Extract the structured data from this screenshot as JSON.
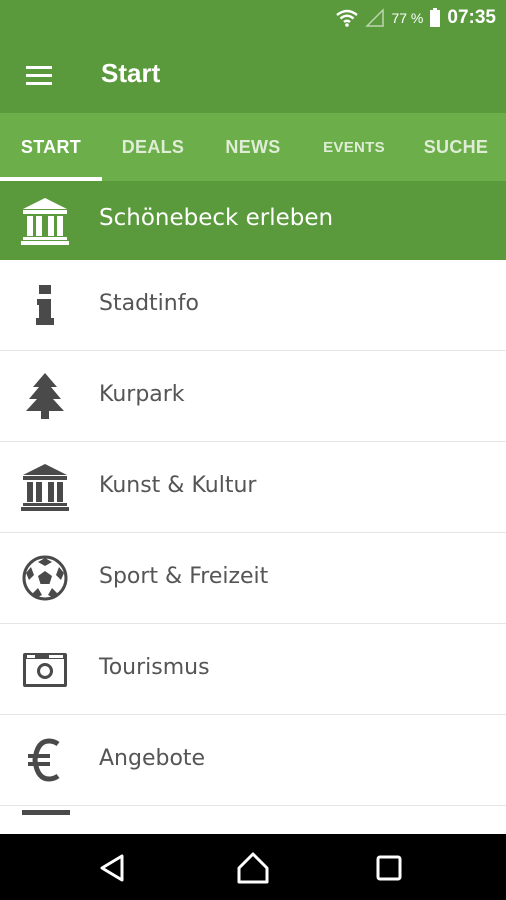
{
  "status_bar": {
    "battery_percent": "77 %",
    "time": "07:35",
    "icons": [
      "wifi-icon",
      "signal-icon",
      "battery-icon"
    ]
  },
  "app_bar": {
    "title": "Start",
    "menu_icon": "hamburger-menu-icon"
  },
  "tabs": [
    {
      "label": "START",
      "active": true
    },
    {
      "label": "DEALS",
      "active": false
    },
    {
      "label": "NEWS",
      "active": false
    },
    {
      "label": "EVENTS",
      "active": false
    },
    {
      "label": "SUCHE",
      "active": false
    }
  ],
  "featured": {
    "label": "Schönebeck erleben",
    "icon": "museum-icon"
  },
  "list": [
    {
      "label": "Stadtinfo",
      "icon": "info-icon"
    },
    {
      "label": "Kurpark",
      "icon": "tree-icon"
    },
    {
      "label": "Kunst & Kultur",
      "icon": "museum-icon"
    },
    {
      "label": "Sport & Freizeit",
      "icon": "soccer-ball-icon"
    },
    {
      "label": "Tourismus",
      "icon": "camera-icon"
    },
    {
      "label": "Angebote",
      "icon": "euro-icon"
    }
  ],
  "nav_bar": {
    "buttons": [
      "back-icon",
      "home-icon",
      "recents-icon"
    ]
  },
  "colors": {
    "primary": "#5b9a3c",
    "tab_bar": "#6caf4a",
    "icon": "#4a4a4a",
    "text": "#555555"
  }
}
